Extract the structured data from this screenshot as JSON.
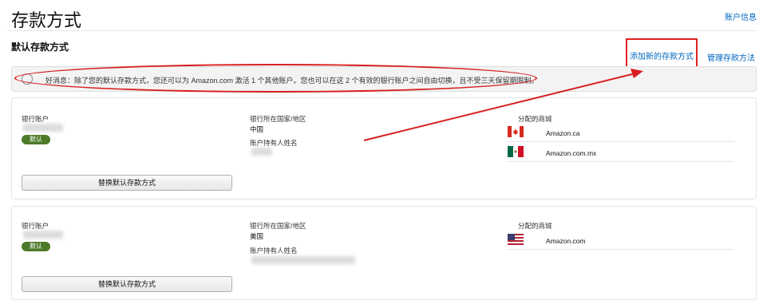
{
  "header": {
    "title": "存款方式",
    "account_info_link": "账户信息"
  },
  "section": {
    "title": "默认存款方式",
    "add_method_link": "添加新的存款方式",
    "manage_methods_link": "管理存款方法"
  },
  "notice": {
    "text": "好消息：除了您的默认存款方式，您还可以为 Amazon.com 激活 1 个其他账户。您也可以在这 2 个有效的银行账户之间自由切换，且不受三天保留期限制。"
  },
  "cards": [
    {
      "bank_account_label": "银行账户",
      "default_badge": "默认",
      "country_label": "银行所在国家/地区",
      "country_value": "中国",
      "holder_label": "账户持有人姓名",
      "stores_label": "分配的商城",
      "stores": [
        {
          "name": "Amazon.ca",
          "flag": "canada-flag"
        },
        {
          "name": "Amazon.com.mx",
          "flag": "mexico-flag"
        }
      ],
      "replace_button": "替换默认存款方式"
    },
    {
      "bank_account_label": "银行账户",
      "default_badge": "默认",
      "country_label": "银行所在国家/地区",
      "country_value": "美国",
      "holder_label": "账户持有人姓名",
      "stores_label": "分配的商城",
      "stores": [
        {
          "name": "Amazon.com",
          "flag": "usa-flag"
        }
      ],
      "replace_button": "替换默认存款方式"
    }
  ],
  "colors": {
    "link": "#0066c0",
    "annotation_red": "#d81e1e",
    "badge_green": "#4d7a2a"
  }
}
